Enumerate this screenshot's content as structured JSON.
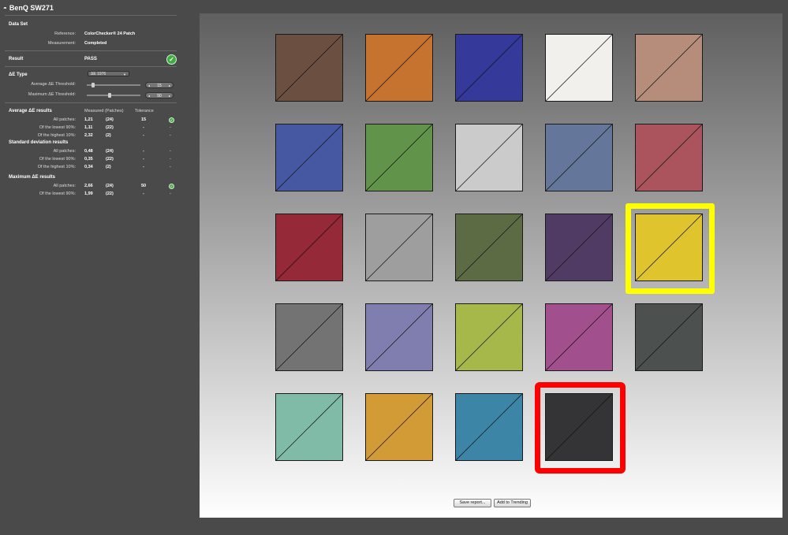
{
  "app": {
    "title": "BenQ SW271",
    "title_icon": "eye-icon"
  },
  "dataset": {
    "heading": "Data Set",
    "reference_label": "Reference:",
    "reference_value": "ColorChecker® 24 Patch",
    "measurement_label": "Measurement:",
    "measurement_value": "Completed"
  },
  "result": {
    "label": "Result",
    "value": "PASS",
    "status_icon": "checkmark-icon",
    "status_color": "#3fae3f"
  },
  "de_type": {
    "label": "ΔE Type",
    "selected": "ΔE 1976",
    "avg_label": "Average  ΔE Threshold:",
    "avg_value": "15",
    "avg_slider_fraction": 0.1,
    "max_label": "Maximum ΔE Threshold:",
    "max_value": "50",
    "max_slider_fraction": 0.42
  },
  "avg_results": {
    "heading": "Average ΔE results",
    "col_measured": "Measured (Patches)",
    "col_tolerance": "Tolerance",
    "rows": [
      {
        "label": "All patches:",
        "measured": "1,21",
        "patches": "(24)",
        "tolerance": "15",
        "flag": "✓"
      },
      {
        "label": "Of the lowest 90%:",
        "measured": "1,11",
        "patches": "(22)",
        "tolerance": "-",
        "flag": "-"
      },
      {
        "label": "Of the highest 10%:",
        "measured": "2,32",
        "patches": "(2)",
        "tolerance": "-",
        "flag": "-"
      }
    ]
  },
  "std_results": {
    "heading": "Standard deviation results",
    "rows": [
      {
        "label": "All patches:",
        "measured": "0,48",
        "patches": "(24)",
        "tolerance": "-",
        "flag": "-"
      },
      {
        "label": "Of the lowest 90%:",
        "measured": "0,35",
        "patches": "(22)",
        "tolerance": "-",
        "flag": "-"
      },
      {
        "label": "Of the highest 10%:",
        "measured": "0,34",
        "patches": "(2)",
        "tolerance": "-",
        "flag": "-"
      }
    ]
  },
  "max_results": {
    "heading": "Maximum ΔE results",
    "rows": [
      {
        "label": "All patches:",
        "measured": "2,66",
        "patches": "(24)",
        "tolerance": "50",
        "flag": "✓"
      },
      {
        "label": "Of the lowest 90%:",
        "measured": "1,99",
        "patches": "(22)",
        "tolerance": "-",
        "flag": "-"
      }
    ]
  },
  "patches": [
    {
      "color": "#6b4f41"
    },
    {
      "color": "#c5732e"
    },
    {
      "color": "#34399a"
    },
    {
      "color": "#f2f0ec"
    },
    {
      "color": "#b68d7a"
    },
    {
      "color": "#4758a2"
    },
    {
      "color": "#61934a"
    },
    {
      "color": "#cbcbcb"
    },
    {
      "color": "#647699"
    },
    {
      "color": "#ab545e"
    },
    {
      "color": "#952937"
    },
    {
      "color": "#9e9e9e"
    },
    {
      "color": "#5d6b44"
    },
    {
      "color": "#503b65"
    },
    {
      "color": "#dfc42e",
      "highlight": "yellow"
    },
    {
      "color": "#737373"
    },
    {
      "color": "#7f7eaf"
    },
    {
      "color": "#a6b84a"
    },
    {
      "color": "#a24f8e"
    },
    {
      "color": "#4c5150"
    },
    {
      "color": "#80bba7"
    },
    {
      "color": "#d39b35"
    },
    {
      "color": "#3c85a6"
    },
    {
      "color": "#343436",
      "highlight": "red"
    }
  ],
  "highlight_colors": {
    "yellow": "#ffff00",
    "red": "#ff0000"
  },
  "buttons": {
    "save_report": "Save report...",
    "add_trending": "Add to Trending"
  }
}
